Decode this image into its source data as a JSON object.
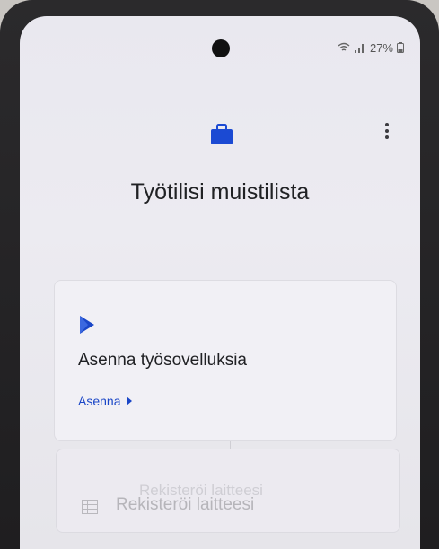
{
  "status_bar": {
    "battery_text": "27%",
    "icons": [
      "wifi-icon",
      "signal-icon",
      "battery-icon"
    ]
  },
  "header": {
    "app_icon": "briefcase-icon",
    "menu_icon": "more-vert-icon",
    "title": "Työtilisi muistilista"
  },
  "checklist": {
    "items": [
      {
        "icon": "play-store-icon",
        "title": "Asenna työsovelluksia",
        "action_label": "Asenna",
        "action_icon": "arrow-right-icon"
      },
      {
        "icon": "device-icon",
        "title": "Rekisteröi laitteesi",
        "ghost_text": "Rekisteröi laitteesi"
      }
    ]
  },
  "colors": {
    "accent": "#1a46c7",
    "briefcase": "#1b4ad3",
    "text_primary": "#202124",
    "disabled_text": "#b6b5ba"
  }
}
